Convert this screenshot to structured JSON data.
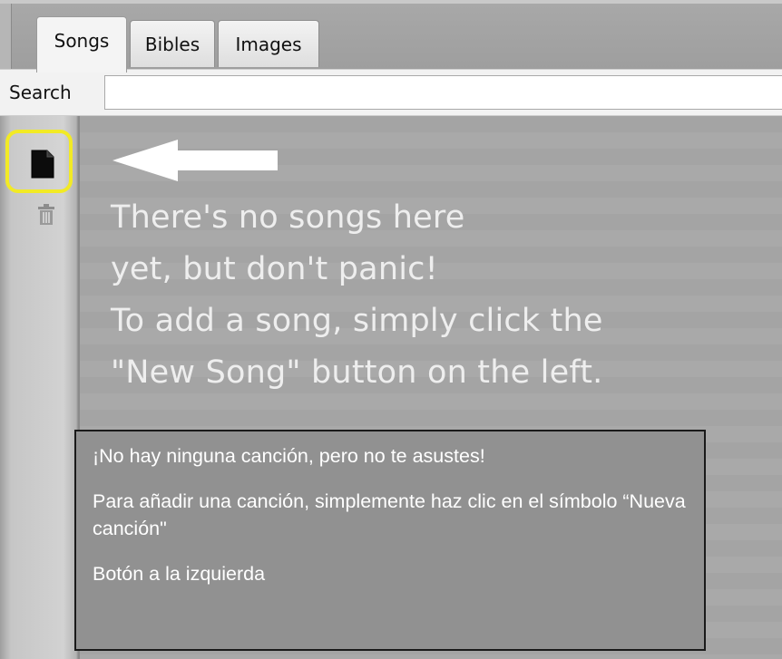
{
  "tabs": [
    {
      "label": "Songs",
      "active": true
    },
    {
      "label": "Bibles",
      "active": false
    },
    {
      "label": "Images",
      "active": false
    }
  ],
  "search": {
    "label": "Search",
    "value": "",
    "placeholder": ""
  },
  "toolbar": {
    "new_song_icon": "document-icon",
    "delete_icon": "trash-icon",
    "highlight_color": "#f2ea25"
  },
  "empty_state": {
    "arrow_icon": "arrow-left-icon",
    "lines": [
      "There's no songs here",
      "yet, but don't panic!",
      "To add a song, simply click the",
      "\"New Song\" button on the left."
    ]
  },
  "translation": {
    "line1": "¡No hay ninguna canción, pero no te asustes!",
    "line2": "Para añadir una canción, simplemente haz clic en el símbolo “Nueva canción\"",
    "line3": "Botón a la izquierda"
  }
}
